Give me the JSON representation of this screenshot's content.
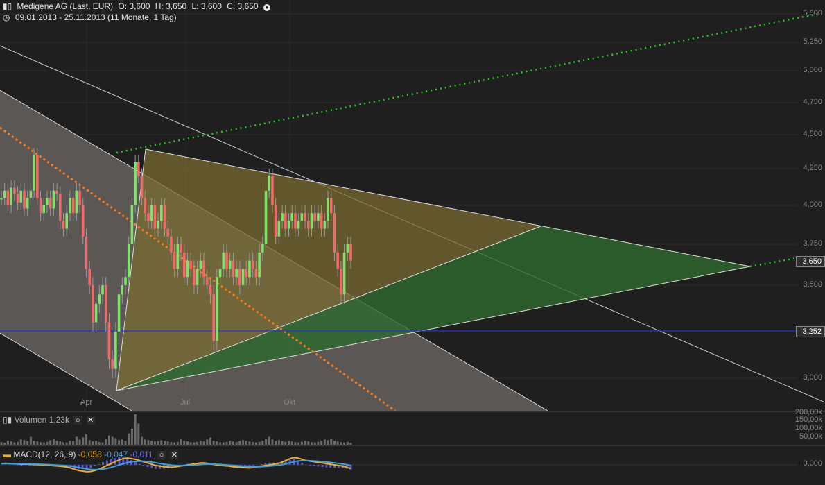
{
  "header": {
    "title": "Medigene AG (Last, EUR)",
    "ohlc": {
      "o": "O: 3,600",
      "h": "H: 3,650",
      "l": "L: 3,600",
      "c": "C: 3,650"
    },
    "range": "09.01.2013 - 25.11.2013 (11 Monate, 1 Tag)"
  },
  "volume_panel": {
    "label": "Volumen",
    "value": "1,23k",
    "ticks": [
      "200,00k",
      "150,00k",
      "100,00k",
      "50,00k"
    ]
  },
  "macd_panel": {
    "label": "MACD(12, 26, 9)",
    "v1": "-0,058",
    "v2": "-0,047",
    "v3": "-0,011",
    "ticks": [
      "0,000"
    ]
  },
  "price_tags": {
    "last": "3,650",
    "line": "3,252"
  },
  "colors": {
    "up": "#7fe36a",
    "down": "#f06a6a",
    "line_blue": "#2233dd",
    "dotted_green": "#22cc22",
    "dotted_orange": "#ff7a1a",
    "tri_fill": "#6b5e2e",
    "green_fill": "#2f5a2f"
  },
  "chart_data": {
    "type": "candlestick",
    "x_ticks": [
      "Apr",
      "Jul",
      "Okt"
    ],
    "y_ticks": [
      "5,500",
      "5,250",
      "5,000",
      "4,750",
      "4,500",
      "4,250",
      "4,000",
      "3,750",
      "3,500",
      "3,000"
    ],
    "ylim": [
      2.75,
      5.5
    ],
    "date_range": [
      "09.01.2013",
      "25.11.2013"
    ],
    "horizontal_line": 3.252,
    "last_price": 3.65,
    "closes": [
      4.05,
      4.1,
      4.0,
      4.12,
      4.08,
      4.02,
      4.1,
      3.98,
      4.05,
      4.1,
      4.35,
      4.05,
      3.95,
      4.0,
      4.05,
      3.98,
      4.1,
      4.08,
      3.9,
      3.85,
      3.95,
      4.05,
      3.95,
      4.1,
      4.0,
      3.8,
      3.6,
      3.5,
      3.3,
      3.4,
      3.45,
      3.5,
      3.3,
      3.1,
      3.05,
      3.25,
      3.45,
      3.5,
      3.55,
      3.75,
      4.0,
      4.3,
      4.2,
      4.05,
      3.95,
      3.9,
      4.0,
      3.85,
      3.9,
      4.0,
      3.85,
      3.8,
      3.7,
      3.6,
      3.75,
      3.7,
      3.55,
      3.65,
      3.6,
      3.5,
      3.6,
      3.65,
      3.55,
      3.5,
      3.45,
      3.2,
      3.55,
      3.6,
      3.7,
      3.6,
      3.65,
      3.55,
      3.6,
      3.5,
      3.6,
      3.55,
      3.65,
      3.6,
      3.55,
      3.7,
      3.75,
      4.1,
      4.2,
      4.0,
      3.8,
      3.9,
      3.95,
      3.85,
      3.9,
      3.95,
      3.85,
      3.9,
      3.95,
      3.9,
      3.85,
      3.95,
      3.9,
      3.95,
      3.85,
      3.9,
      4.05,
      3.95,
      3.7,
      3.6,
      3.45,
      3.7,
      3.75,
      3.65
    ],
    "volume": [
      20,
      15,
      30,
      25,
      18,
      22,
      40,
      35,
      28,
      60,
      30,
      25,
      20,
      18,
      22,
      35,
      45,
      30,
      25,
      20,
      18,
      30,
      28,
      60,
      40,
      55,
      80,
      35,
      25,
      30,
      20,
      18,
      45,
      70,
      60,
      50,
      35,
      40,
      30,
      85,
      120,
      230,
      160,
      60,
      40,
      35,
      30,
      25,
      28,
      35,
      30,
      25,
      20,
      18,
      22,
      45,
      30,
      25,
      20,
      18,
      22,
      30,
      25,
      40,
      55,
      30,
      25,
      20,
      18,
      22,
      30,
      25,
      20,
      28,
      35,
      30,
      25,
      20,
      18,
      22,
      30,
      45,
      60,
      40,
      30,
      35,
      28,
      22,
      30,
      25,
      20,
      18,
      22,
      30,
      25,
      20,
      18,
      22,
      30,
      40,
      35,
      45,
      30,
      25,
      20,
      18,
      22,
      15
    ],
    "macd": [
      0.02,
      0.025,
      0.02,
      0.018,
      0.015,
      0.01,
      0.012,
      0.008,
      0.005,
      0.003,
      0.0,
      -0.005,
      -0.01,
      -0.015,
      -0.02,
      -0.025,
      -0.035,
      -0.05,
      -0.07,
      -0.09,
      -0.1,
      -0.11,
      -0.105,
      -0.09,
      -0.07,
      -0.04,
      -0.01,
      0.02,
      0.05,
      0.08,
      0.1,
      0.11,
      0.1,
      0.09,
      0.07,
      0.05,
      0.03,
      0.01,
      -0.01,
      -0.02,
      -0.03,
      -0.035,
      -0.04,
      -0.03,
      -0.02,
      -0.01,
      0.0,
      0.01,
      0.02,
      0.03,
      0.03,
      0.02,
      0.01,
      0.0,
      -0.01,
      -0.015,
      -0.02,
      -0.03,
      -0.035,
      -0.04,
      -0.045,
      -0.05,
      -0.04,
      -0.03,
      -0.02,
      -0.01,
      0.0,
      0.01,
      0.02,
      0.04,
      0.07,
      0.1,
      0.12,
      0.11,
      0.09,
      0.07,
      0.06,
      0.05,
      0.04,
      0.03,
      0.02,
      0.01,
      0.0,
      -0.01,
      -0.02,
      -0.04,
      -0.058
    ]
  }
}
